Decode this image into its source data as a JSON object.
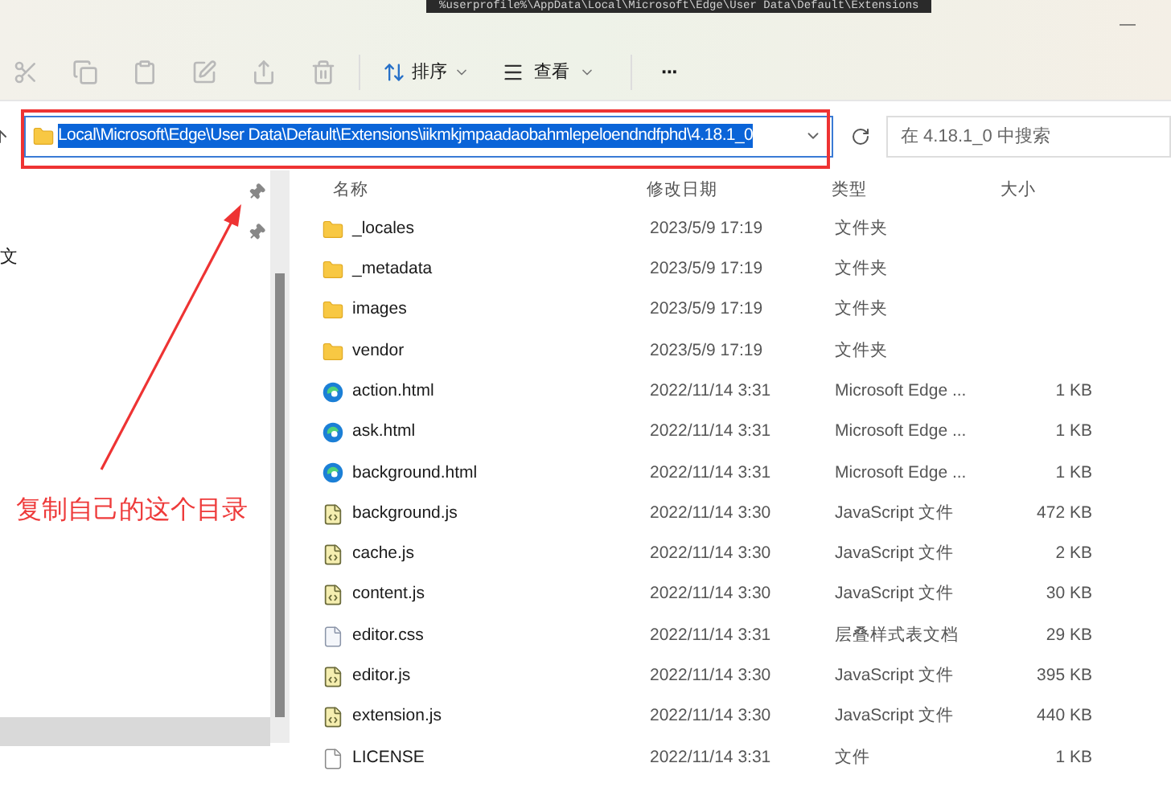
{
  "terminal_strip": {
    "text": "%userprofile%\\AppData\\Local\\Microsoft\\Edge\\User Data\\Default\\Extensions"
  },
  "window": {
    "minimize": "—"
  },
  "toolbar": {
    "sort": "排序",
    "view": "查看",
    "more": "···"
  },
  "address_bar": {
    "path": "Local\\Microsoft\\Edge\\User Data\\Default\\Extensions\\iikmkjmpaadaobahmlepeloendndfphd\\4.18.1_0",
    "selected": true
  },
  "search": {
    "placeholder": "在 4.18.1_0 中搜索"
  },
  "nav_pane": {
    "items": [
      {
        "label": "文",
        "selected": false
      },
      {
        "selected": true
      }
    ]
  },
  "table": {
    "columns": [
      "名称",
      "修改日期",
      "类型",
      "大小"
    ],
    "rows": [
      {
        "kind": "folder",
        "name": "_locales",
        "date": "2023/5/9 17:19",
        "type": "文件夹"
      },
      {
        "kind": "folder",
        "name": "_metadata",
        "date": "2023/5/9 17:19",
        "type": "文件夹"
      },
      {
        "kind": "folder",
        "name": "images",
        "date": "2023/5/9 17:19",
        "type": "文件夹"
      },
      {
        "kind": "folder",
        "name": "vendor",
        "date": "2023/5/9 17:19",
        "type": "文件夹"
      },
      {
        "kind": "edge",
        "name": "action.html",
        "date": "2022/11/14 3:31",
        "type": "Microsoft Edge ...",
        "size": "1 KB"
      },
      {
        "kind": "edge",
        "name": "ask.html",
        "date": "2022/11/14 3:31",
        "type": "Microsoft Edge ...",
        "size": "1 KB"
      },
      {
        "kind": "edge",
        "name": "background.html",
        "date": "2022/11/14 3:31",
        "type": "Microsoft Edge ...",
        "size": "1 KB"
      },
      {
        "kind": "js",
        "name": "background.js",
        "date": "2022/11/14 3:30",
        "type": "JavaScript 文件",
        "size": "472 KB"
      },
      {
        "kind": "js",
        "name": "cache.js",
        "date": "2022/11/14 3:30",
        "type": "JavaScript 文件",
        "size": "2 KB"
      },
      {
        "kind": "js",
        "name": "content.js",
        "date": "2022/11/14 3:30",
        "type": "JavaScript 文件",
        "size": "30 KB"
      },
      {
        "kind": "css",
        "name": "editor.css",
        "date": "2022/11/14 3:31",
        "type": "层叠样式表文档",
        "size": "29 KB"
      },
      {
        "kind": "js",
        "name": "editor.js",
        "date": "2022/11/14 3:30",
        "type": "JavaScript 文件",
        "size": "395 KB"
      },
      {
        "kind": "js",
        "name": "extension.js",
        "date": "2022/11/14 3:30",
        "type": "JavaScript 文件",
        "size": "440 KB"
      },
      {
        "kind": "file",
        "name": "LICENSE",
        "date": "2022/11/14 3:31",
        "type": "文件",
        "size": "1 KB"
      }
    ]
  },
  "annotation": {
    "text": "复制自己的这个目录"
  }
}
